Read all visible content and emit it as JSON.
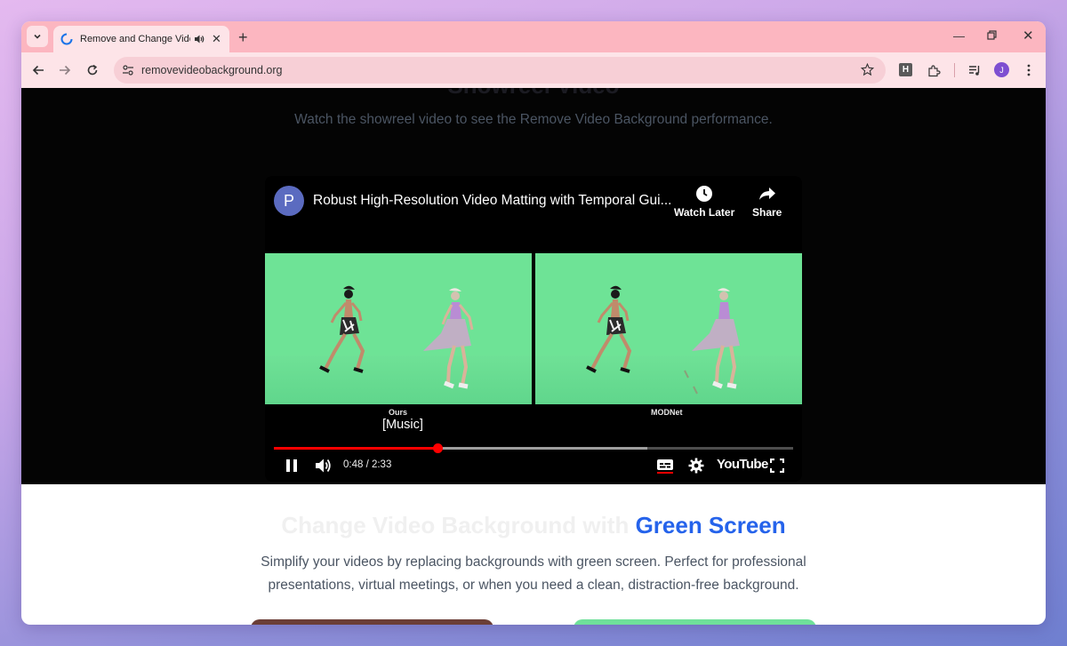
{
  "browser": {
    "tab": {
      "title": "Remove and Change Video Background"
    },
    "address_bar": {
      "url": "removevideobackground.org"
    },
    "profile_initial": "J",
    "extension_letter": "H"
  },
  "page": {
    "showreel": {
      "subtitle": "Watch the showreel video to see the Remove Video Background performance."
    },
    "player": {
      "channel_initial": "P",
      "video_title": "Robust High-Resolution Video Matting with Temporal Gui...",
      "watch_later_label": "Watch Later",
      "share_label": "Share",
      "left_label": "Ours",
      "right_label": "MODNet",
      "caption": "[Music]",
      "time": "0:48 / 2:33",
      "played_fraction": 0.316,
      "buffered_fraction": 0.72,
      "logo_text": "YouTube"
    },
    "green_screen": {
      "title_prefix": "Change Video Background with ",
      "title_accent": "Green Screen",
      "description": "Simplify your videos by replacing backgrounds with green screen. Perfect for professional presentations, virtual meetings, or when you need a clean, distraction-free background."
    }
  },
  "colors": {
    "accent": "#2563eb",
    "progress": "#ff0000",
    "green_screen": "#6ee396"
  }
}
